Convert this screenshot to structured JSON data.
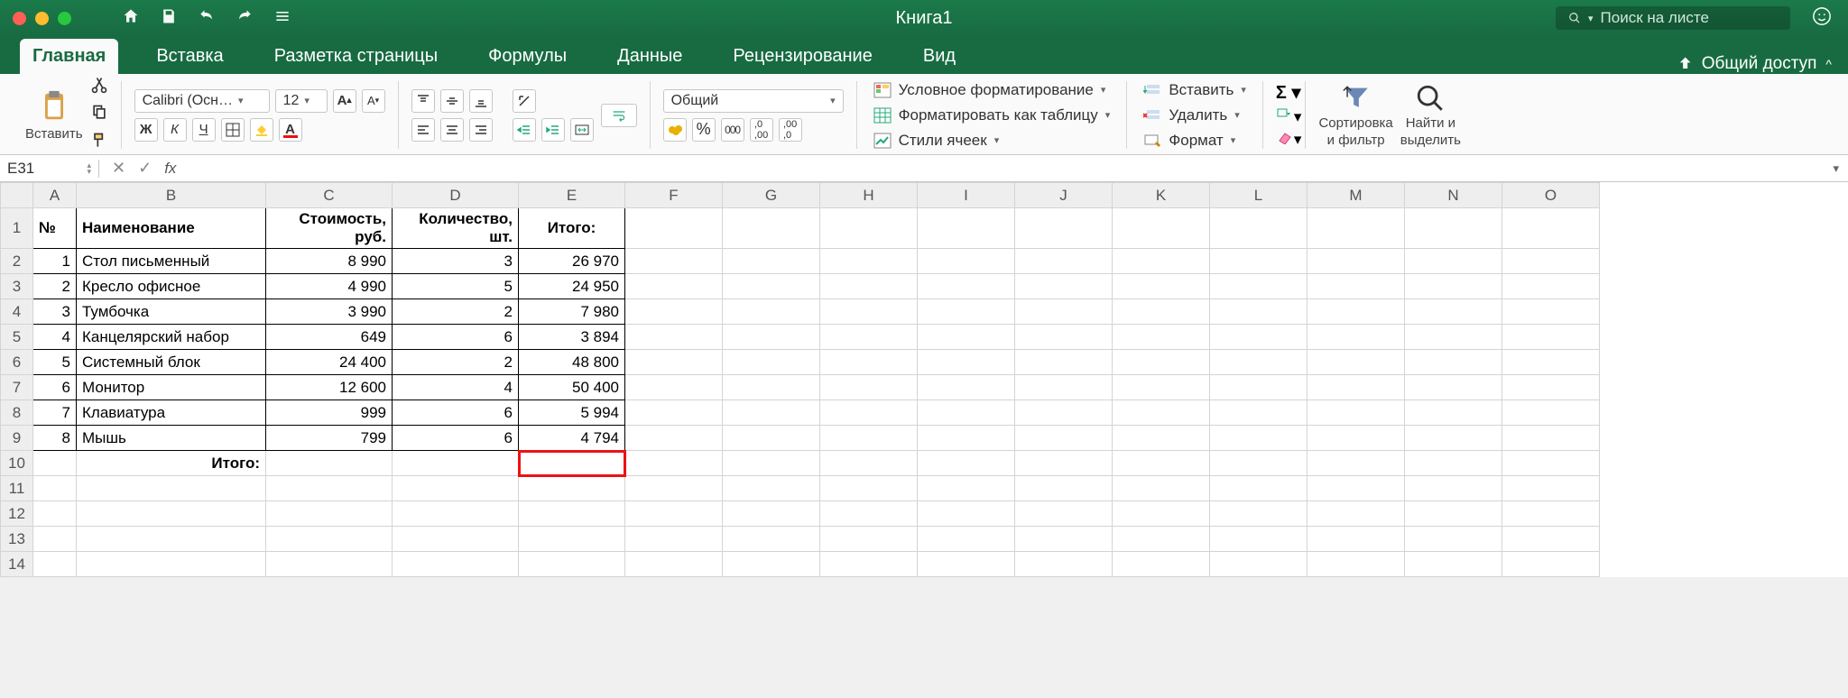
{
  "window": {
    "title": "Книга1",
    "search_placeholder": "Поиск на листе"
  },
  "tabs": {
    "home": "Главная",
    "insert": "Вставка",
    "layout": "Разметка страницы",
    "formulas": "Формулы",
    "data": "Данные",
    "review": "Рецензирование",
    "view": "Вид",
    "share": "Общий доступ"
  },
  "ribbon": {
    "paste": "Вставить",
    "font_name": "Calibri (Осн…",
    "font_size": "12",
    "bold": "Ж",
    "italic": "К",
    "underline": "Ч",
    "number_format": "Общий",
    "percent": "%",
    "thousands": "000",
    "cond_format": "Условное форматирование",
    "as_table": "Форматировать как таблицу",
    "cell_styles": "Стили ячеек",
    "insert": "Вставить",
    "delete": "Удалить",
    "format": "Формат",
    "sort": "Сортировка",
    "filter": "и фильтр",
    "find1": "Найти и",
    "find2": "выделить"
  },
  "formula_bar": {
    "cell_ref": "E31",
    "fx": "fx",
    "formula": ""
  },
  "columns": [
    "",
    "A",
    "B",
    "C",
    "D",
    "E",
    "F",
    "G",
    "H",
    "I",
    "J",
    "K",
    "L",
    "M",
    "N",
    "O"
  ],
  "sheet": {
    "headers": {
      "no": "№",
      "name": "Наименование",
      "cost": "Стоимость, руб.",
      "qty": "Количество, шт.",
      "total": "Итого:"
    },
    "rows": [
      {
        "no": "1",
        "name": "Стол письменный",
        "cost": "8 990",
        "qty": "3",
        "total": "26 970"
      },
      {
        "no": "2",
        "name": "Кресло офисное",
        "cost": "4 990",
        "qty": "5",
        "total": "24 950"
      },
      {
        "no": "3",
        "name": "Тумбочка",
        "cost": "3 990",
        "qty": "2",
        "total": "7 980"
      },
      {
        "no": "4",
        "name": "Канцелярский набор",
        "cost": "649",
        "qty": "6",
        "total": "3 894"
      },
      {
        "no": "5",
        "name": "Системный блок",
        "cost": "24 400",
        "qty": "2",
        "total": "48 800"
      },
      {
        "no": "6",
        "name": "Монитор",
        "cost": "12 600",
        "qty": "4",
        "total": "50 400"
      },
      {
        "no": "7",
        "name": "Клавиатура",
        "cost": "999",
        "qty": "6",
        "total": "5 994"
      },
      {
        "no": "8",
        "name": "Мышь",
        "cost": "799",
        "qty": "6",
        "total": "4 794"
      }
    ],
    "footer_label": "Итого:"
  },
  "chart_data": {
    "type": "table",
    "title": "Книга1",
    "columns": [
      "№",
      "Наименование",
      "Стоимость, руб.",
      "Количество, шт.",
      "Итого:"
    ],
    "rows": [
      [
        1,
        "Стол письменный",
        8990,
        3,
        26970
      ],
      [
        2,
        "Кресло офисное",
        4990,
        5,
        24950
      ],
      [
        3,
        "Тумбочка",
        3990,
        2,
        7980
      ],
      [
        4,
        "Канцелярский набор",
        649,
        6,
        3894
      ],
      [
        5,
        "Системный блок",
        24400,
        2,
        48800
      ],
      [
        6,
        "Монитор",
        12600,
        4,
        50400
      ],
      [
        7,
        "Клавиатура",
        999,
        6,
        5994
      ],
      [
        8,
        "Мышь",
        799,
        6,
        4794
      ]
    ],
    "footer": [
      "",
      "Итого:",
      "",
      "",
      ""
    ]
  }
}
